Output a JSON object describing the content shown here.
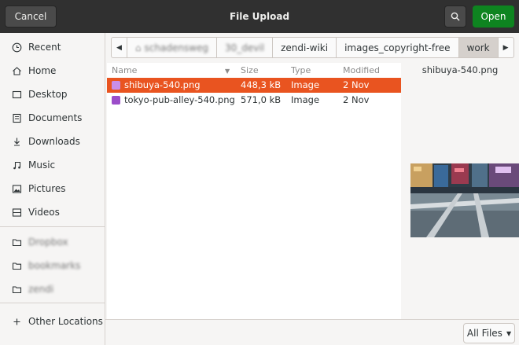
{
  "header": {
    "title": "File Upload",
    "cancel_label": "Cancel",
    "open_label": "Open",
    "search_icon": "search-icon"
  },
  "sidebar": {
    "items": [
      {
        "label": "Recent",
        "icon": "clock-icon"
      },
      {
        "label": "Home",
        "icon": "home-icon"
      },
      {
        "label": "Desktop",
        "icon": "desktop-icon"
      },
      {
        "label": "Documents",
        "icon": "document-icon"
      },
      {
        "label": "Downloads",
        "icon": "download-icon"
      },
      {
        "label": "Music",
        "icon": "music-icon"
      },
      {
        "label": "Pictures",
        "icon": "picture-icon"
      },
      {
        "label": "Videos",
        "icon": "video-icon"
      }
    ],
    "bookmarks": [
      {
        "label": "Dropbox",
        "icon": "folder-icon"
      },
      {
        "label": "bookmarks",
        "icon": "folder-icon"
      },
      {
        "label": "zendi",
        "icon": "folder-icon"
      }
    ],
    "other_locations": "Other Locations"
  },
  "pathbar": {
    "crumbs": [
      "schadensweg",
      "30_devil",
      "zendi-wiki",
      "images_copyright-free",
      "work"
    ],
    "active_index": 4
  },
  "filelist": {
    "columns": {
      "name": "Name",
      "size": "Size",
      "type": "Type",
      "modified": "Modified"
    },
    "rows": [
      {
        "name": "shibuya-540.png",
        "size": "448,3 kB",
        "type": "Image",
        "modified": "2 Nov",
        "selected": true
      },
      {
        "name": "tokyo-pub-alley-540.png",
        "size": "571,0 kB",
        "type": "Image",
        "modified": "2 Nov",
        "selected": false
      }
    ]
  },
  "preview": {
    "filename": "shibuya-540.png"
  },
  "filter": {
    "label": "All Files"
  },
  "colors": {
    "header_bg": "#303030",
    "open_button": "#0e8420",
    "selection": "#e95420"
  }
}
